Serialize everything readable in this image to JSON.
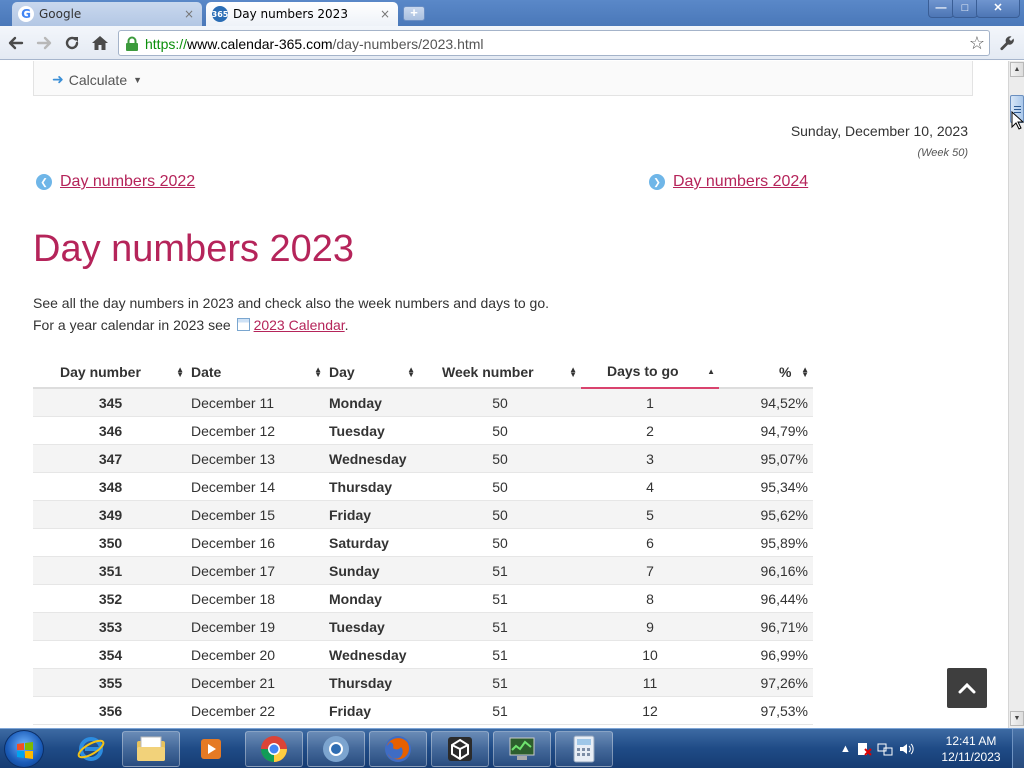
{
  "browser": {
    "tabs": [
      {
        "label": "Google",
        "favicon": "google-favicon",
        "close": "×",
        "active": false
      },
      {
        "label": "Day numbers 2023",
        "favicon": "calendar365-favicon",
        "favicon_text": "365",
        "close": "×",
        "active": true
      }
    ],
    "new_tab": "+",
    "window_controls": {
      "minimize": "—",
      "maximize": "□",
      "close": "✕"
    },
    "url": {
      "scheme": "https://",
      "host": "www.calendar-365.com",
      "path": "/day-numbers/2023.html"
    },
    "icons": {
      "back": "back-arrow-icon",
      "forward": "forward-arrow-icon",
      "reload": "reload-icon",
      "home": "home-icon",
      "lock": "lock-icon",
      "bookmark": "star-icon",
      "menu": "wrench-icon"
    }
  },
  "page": {
    "calculate_label": "Calculate",
    "current_date": "Sunday, December 10, 2023",
    "current_week": "(Week 50)",
    "prev_year_link": "Day numbers 2022",
    "next_year_link": "Day numbers 2024",
    "title": "Day numbers 2023",
    "intro_line1": "See all the day numbers in 2023 and check also the week numbers and days to go.",
    "intro_line2_prefix": "For a year calendar in 2023 see",
    "calendar_link": "2023 Calendar",
    "intro_line2_suffix": ".",
    "accent_color": "#b5245a"
  },
  "table": {
    "headers": [
      "Day number",
      "Date",
      "Day",
      "Week number",
      "Days to go",
      "%"
    ],
    "sorted_column": "Days to go",
    "rows": [
      {
        "day_number": "345",
        "date": "December 11",
        "day": "Monday",
        "week": "50",
        "days_to_go": "1",
        "percent": "94,52%"
      },
      {
        "day_number": "346",
        "date": "December 12",
        "day": "Tuesday",
        "week": "50",
        "days_to_go": "2",
        "percent": "94,79%"
      },
      {
        "day_number": "347",
        "date": "December 13",
        "day": "Wednesday",
        "week": "50",
        "days_to_go": "3",
        "percent": "95,07%"
      },
      {
        "day_number": "348",
        "date": "December 14",
        "day": "Thursday",
        "week": "50",
        "days_to_go": "4",
        "percent": "95,34%"
      },
      {
        "day_number": "349",
        "date": "December 15",
        "day": "Friday",
        "week": "50",
        "days_to_go": "5",
        "percent": "95,62%"
      },
      {
        "day_number": "350",
        "date": "December 16",
        "day": "Saturday",
        "week": "50",
        "days_to_go": "6",
        "percent": "95,89%"
      },
      {
        "day_number": "351",
        "date": "December 17",
        "day": "Sunday",
        "week": "51",
        "days_to_go": "7",
        "percent": "96,16%"
      },
      {
        "day_number": "352",
        "date": "December 18",
        "day": "Monday",
        "week": "51",
        "days_to_go": "8",
        "percent": "96,44%"
      },
      {
        "day_number": "353",
        "date": "December 19",
        "day": "Tuesday",
        "week": "51",
        "days_to_go": "9",
        "percent": "96,71%"
      },
      {
        "day_number": "354",
        "date": "December 20",
        "day": "Wednesday",
        "week": "51",
        "days_to_go": "10",
        "percent": "96,99%"
      },
      {
        "day_number": "355",
        "date": "December 21",
        "day": "Thursday",
        "week": "51",
        "days_to_go": "11",
        "percent": "97,26%"
      },
      {
        "day_number": "356",
        "date": "December 22",
        "day": "Friday",
        "week": "51",
        "days_to_go": "12",
        "percent": "97,53%"
      }
    ]
  },
  "taskbar": {
    "items": [
      "internet-explorer-icon",
      "file-explorer-icon",
      "media-player-icon",
      "chrome-icon",
      "chrome-alt-icon",
      "firefox-icon",
      "unity-icon",
      "system-monitor-icon",
      "calculator-icon"
    ],
    "clock_time": "12:41 AM",
    "clock_date": "12/11/2023"
  }
}
